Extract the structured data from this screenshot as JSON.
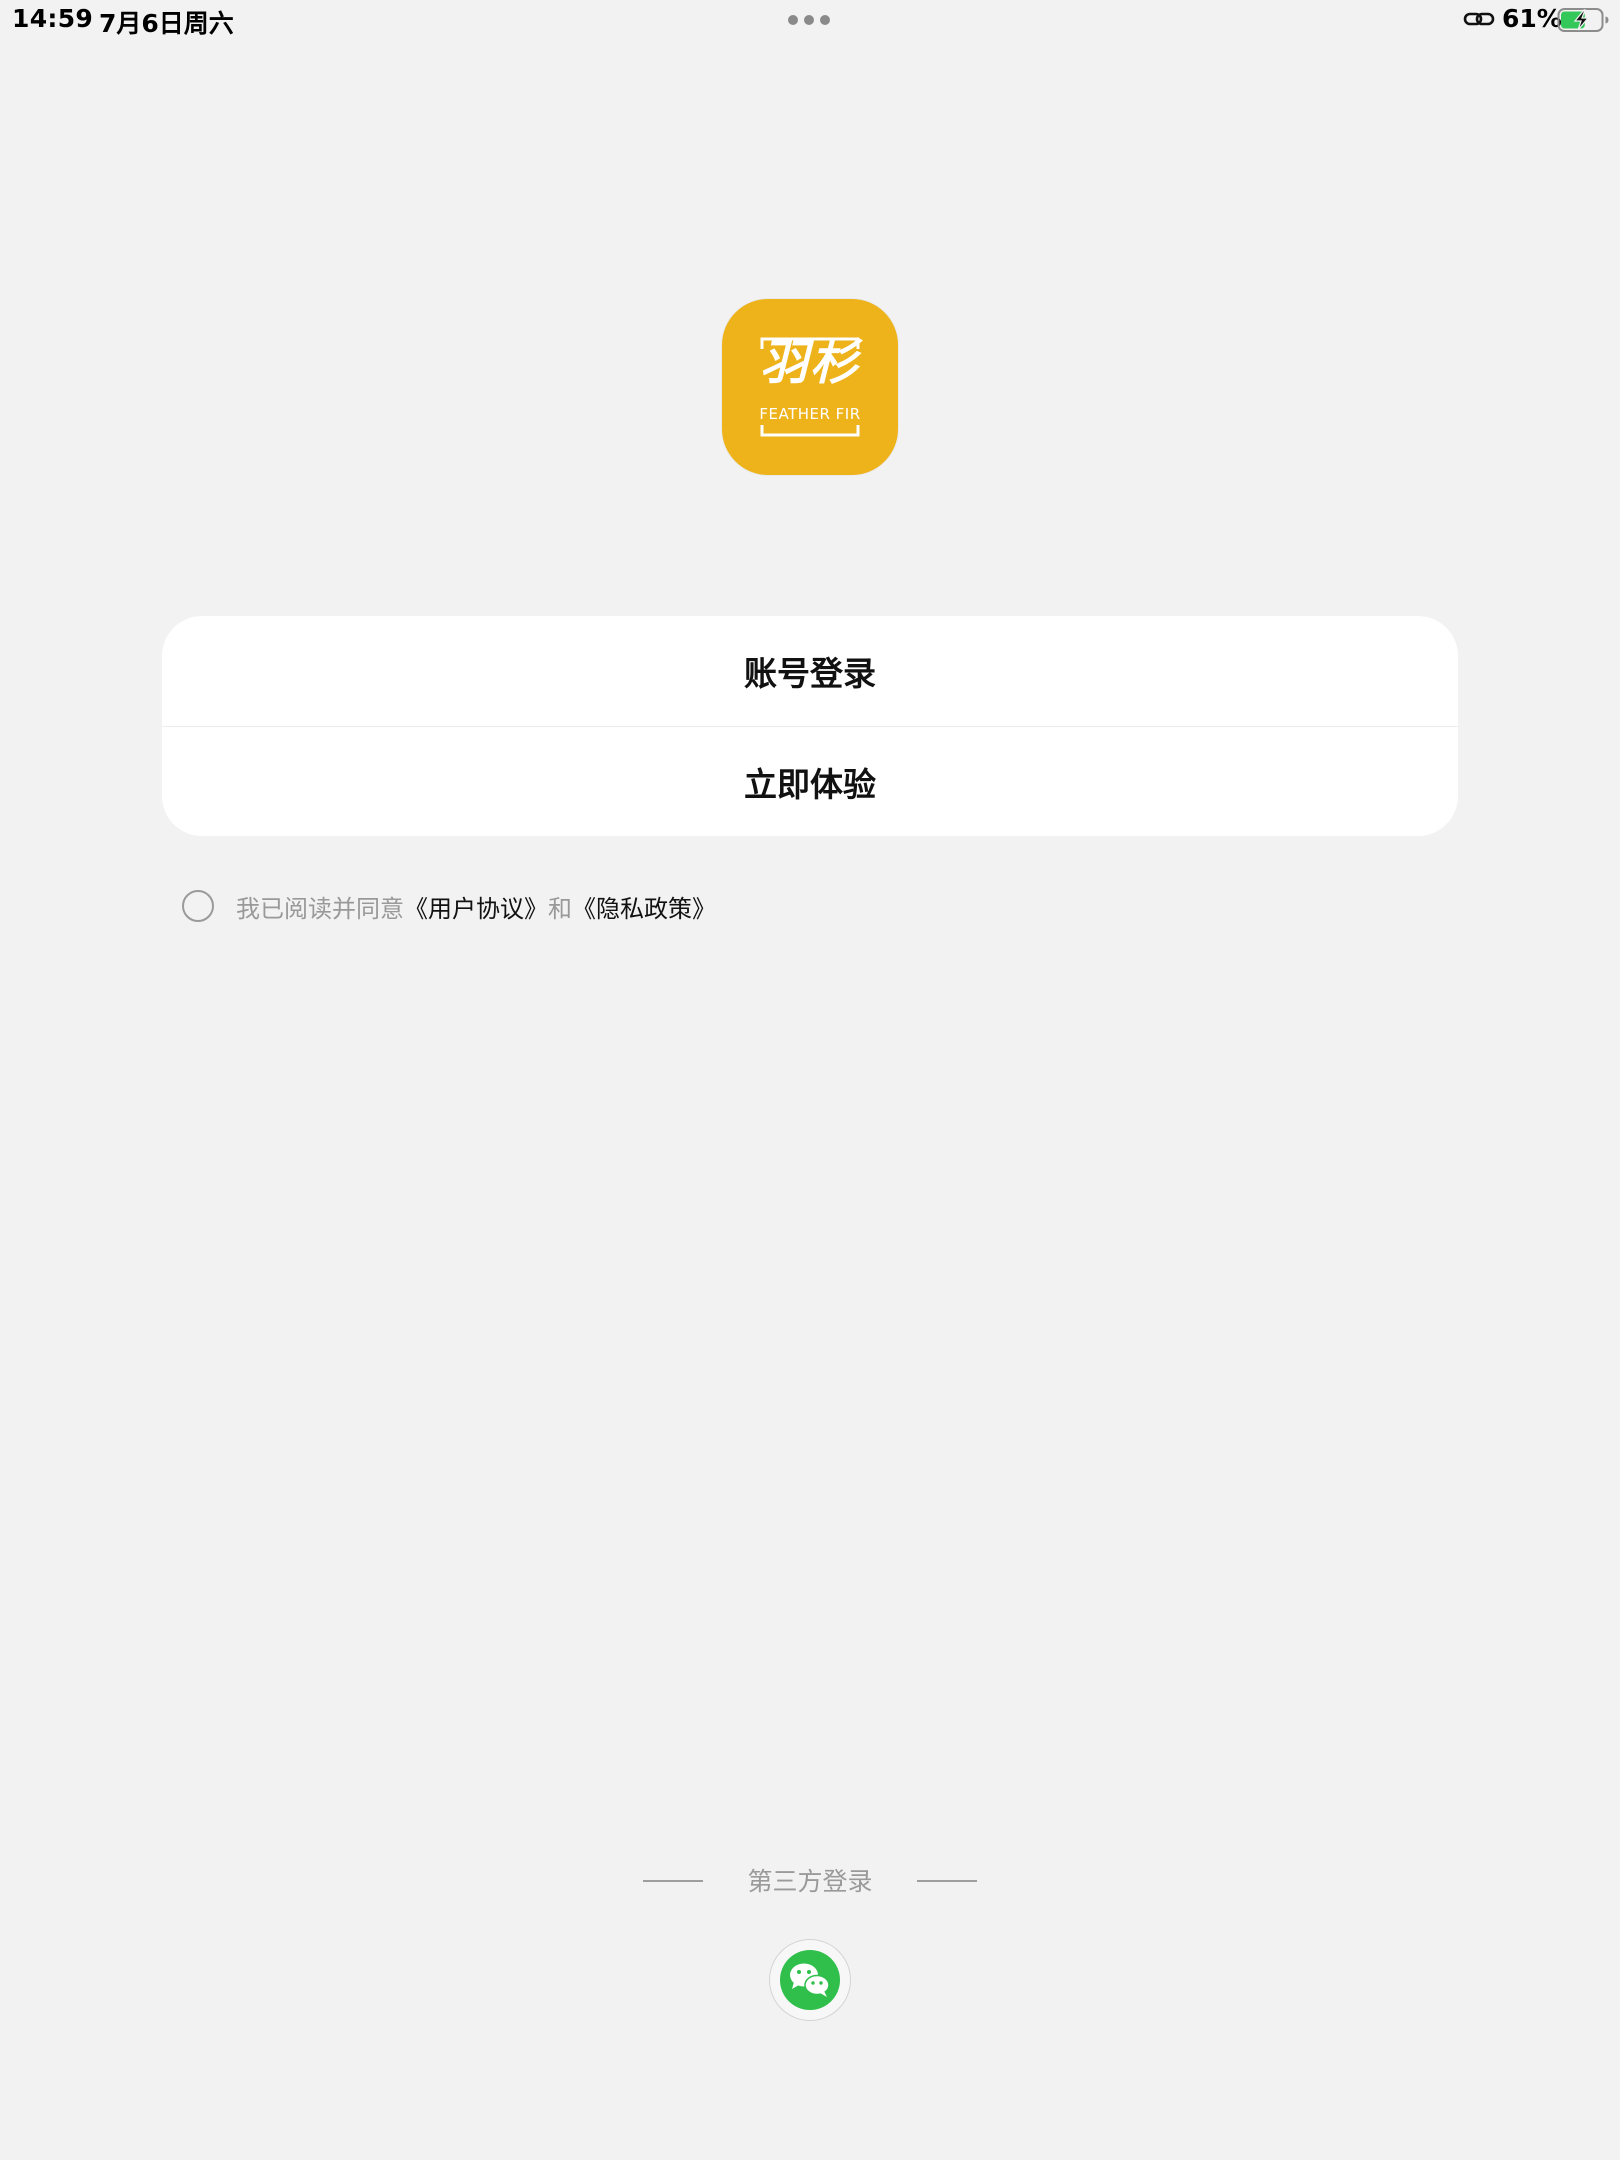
{
  "status_bar": {
    "time": "14:59",
    "date": "7月6日周六",
    "battery_percent": "61%",
    "battery_level": 0.61,
    "charging": true
  },
  "logo": {
    "name_cn": "羽杉",
    "name_en": "FEATHER FIR",
    "color": "#eeb21a"
  },
  "login_options": {
    "account_login": "账号登录",
    "try_now": "立即体验"
  },
  "agreement": {
    "prefix": "我已阅读并同意",
    "user_agreement": "《用户协议》",
    "and": "和",
    "privacy_policy": "《隐私政策》",
    "checked": false
  },
  "third_party": {
    "label": "第三方登录",
    "providers": [
      "wechat-icon"
    ],
    "wechat_color": "#2fbf4a"
  }
}
